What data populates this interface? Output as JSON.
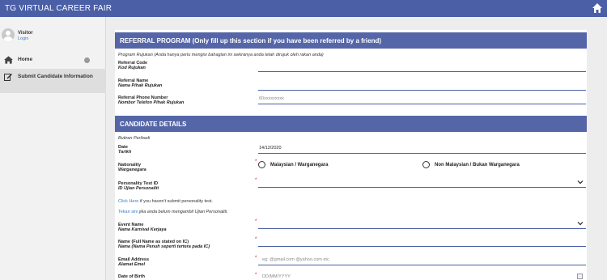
{
  "app": {
    "title": "TG VIRTUAL CAREER FAIR"
  },
  "user": {
    "name": "Visitor",
    "login_label": "Login"
  },
  "sidebar": {
    "items": [
      {
        "label": "Home"
      },
      {
        "label": "Submit Candidate Information"
      }
    ]
  },
  "referral": {
    "header": "REFERRAL PROGRAM (Only fill up this section if you have been referred by a friend)",
    "note": "Program Rujukan (Anda hanya perlu mengisi bahagian ini sekiranya anda telah dirujuk oleh rakan anda)",
    "code": {
      "label": "Referral Code",
      "sub": "Kod Rujukan",
      "value": ""
    },
    "name": {
      "label": "Referral Name",
      "sub": "Nama Pihak Rujukan",
      "value": ""
    },
    "phone": {
      "label": "Referral Phone Number",
      "sub": "Nombor Telefon Pihak Rujukan",
      "placeholder": "60xxxxxxxxx"
    }
  },
  "candidate": {
    "header": "CANDIDATE DETAILS",
    "note": "Butiran Peribadi",
    "date": {
      "label": "Date",
      "sub": "Tarikh",
      "value": "14/12/2020"
    },
    "nationality": {
      "label": "Nationality",
      "sub": "Warganegara",
      "options": [
        "Malaysian / Warganegara",
        "Non Malaysian / Bukan Warganegara"
      ]
    },
    "personality": {
      "label": "Personality Test ID",
      "sub": "ID Ujian Personaliti",
      "value": ""
    },
    "link_en": {
      "link": "Click Here",
      "rest": " if you haven't submit personality test."
    },
    "link_ms": {
      "link": "Tekan sini",
      "rest": " jika anda belum mengambil Ujian Personaliti."
    },
    "event": {
      "label": "Event Name",
      "sub": "Nama Karnival Kerjaya",
      "value": ""
    },
    "fullname": {
      "label": "Name (Full Name as stated on IC)",
      "sub": "Nama (Nama Penuh seperti tertera pada IC)",
      "value": ""
    },
    "email": {
      "label": "Email Address",
      "sub": "Alamat Emel",
      "placeholder": "eg: @gmail.com @yahoo.com etc"
    },
    "dob": {
      "label": "Date of Birth",
      "placeholder": "DD/MM/YYYY"
    },
    "required_mark": "*"
  }
}
